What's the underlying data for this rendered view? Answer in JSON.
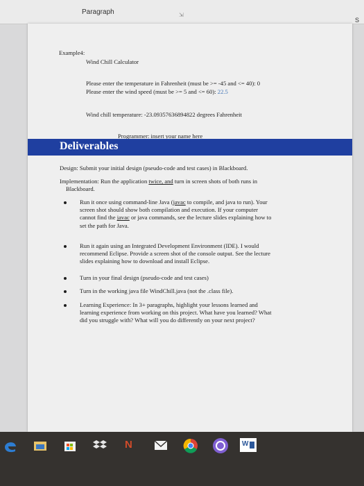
{
  "ribbon": {
    "style_label": "Paragraph",
    "edge_label": "S"
  },
  "example": {
    "heading": "Example4:",
    "title": "Wind Chill Calculator",
    "prompt_temp": "Please enter the temperature in Fahrenheit (must be >= -45 and <= 40): 0",
    "prompt_wind": "Please enter the wind speed (must be >= 5 and <= 60): ",
    "prompt_wind_value": "22.5",
    "result": "Wind chill temperature: -23.09357636894822 degrees Fahrenheit",
    "programmer": "Programmer: insert your name here"
  },
  "deliverables": {
    "heading": "Deliverables",
    "design": "Design: Submit your initial design (pseudo-code and test cases) in Blackboard.",
    "implementation_a": "Implementation: Run the application ",
    "implementation_twice": "twice, and",
    "implementation_b": " turn in screen shots of both runs in",
    "implementation_c": "Blackboard.",
    "bullets": [
      {
        "l1a": "Run it once using command-line Java (",
        "l1b": "javac",
        "l1c": " to compile, and java to run). Your",
        "l2": "screen shot should show both compilation and execution. If your computer",
        "l3a": "cannot find the ",
        "l3b": "javac",
        "l3c": " or java commands, see the lecture slides explaining how to",
        "l4": "set the path for Java."
      },
      {
        "l1": "Run it again using an Integrated Development Environment (IDE). I would",
        "l2": "recommend Eclipse. Provide a screen shot of the console output. See the lecture",
        "l3": "slides explaining how to download and install Eclipse."
      },
      {
        "l1": "Turn in your final design (pseudo-code and test cases)"
      },
      {
        "l1": "Turn in the working java file WindChill.java (not the .class file)."
      },
      {
        "l1": "Learning Experience: In 3+ paragraphs, highlight your lessons learned and",
        "l2": "learning experience from working on this project. What have you learned? What",
        "l3": "did you struggle with? What will you do differently on your next project?"
      }
    ]
  },
  "taskbar": {
    "icons": [
      "edge-icon",
      "file-explorer-icon",
      "store-icon",
      "dropbox-icon",
      "onenote-icon",
      "mail-icon",
      "chrome-icon",
      "skype-icon",
      "word-icon"
    ],
    "onenote_letter": "N",
    "word_letter": "W"
  }
}
